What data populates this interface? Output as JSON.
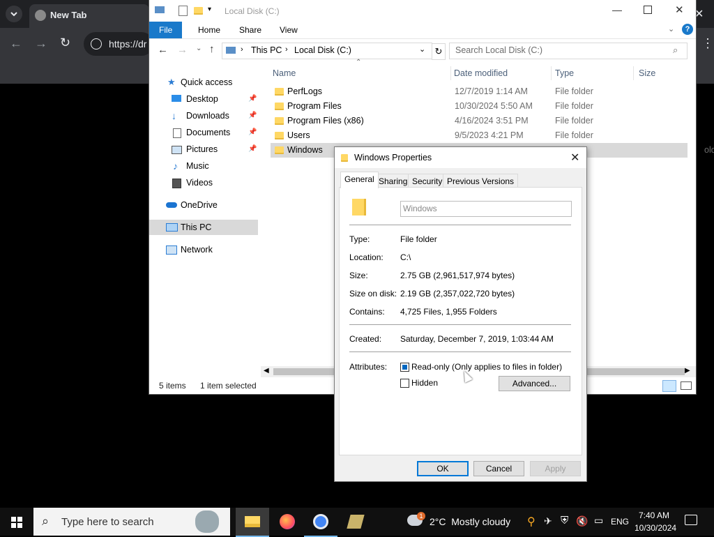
{
  "chrome": {
    "tab_title": "New Tab",
    "url": "https://dr",
    "accent": "#35363a"
  },
  "explorer": {
    "title": "Local Disk (C:)",
    "ribbon_tabs": [
      "File",
      "Home",
      "Share",
      "View"
    ],
    "breadcrumb": [
      "This PC",
      "Local Disk (C:)"
    ],
    "search_placeholder": "Search Local Disk (C:)",
    "nav": {
      "quick_access": "Quick access",
      "desktop": "Desktop",
      "downloads": "Downloads",
      "documents": "Documents",
      "pictures": "Pictures",
      "music": "Music",
      "videos": "Videos",
      "onedrive": "OneDrive",
      "this_pc": "This PC",
      "network": "Network"
    },
    "columns": {
      "name": "Name",
      "date": "Date modified",
      "type": "Type",
      "size": "Size"
    },
    "rows": [
      {
        "name": "PerfLogs",
        "date": "12/7/2019 1:14 AM",
        "type": "File folder"
      },
      {
        "name": "Program Files",
        "date": "10/30/2024 5:50 AM",
        "type": "File folder"
      },
      {
        "name": "Program Files (x86)",
        "date": "4/16/2024 3:51 PM",
        "type": "File folder"
      },
      {
        "name": "Users",
        "date": "9/5/2023 4:21 PM",
        "type": "File folder"
      },
      {
        "name": "Windows",
        "date": "",
        "type": "older"
      }
    ],
    "status_items": "5 items",
    "status_selected": "1 item selected"
  },
  "dialog": {
    "title": "Windows Properties",
    "tabs": [
      "General",
      "Sharing",
      "Security",
      "Previous Versions"
    ],
    "name_value": "Windows",
    "type_label": "Type:",
    "type_value": "File folder",
    "location_label": "Location:",
    "location_value": "C:\\",
    "size_label": "Size:",
    "size_value": "2.75 GB (2,961,517,974 bytes)",
    "size_disk_label": "Size on disk:",
    "size_disk_value": "2.19 GB (2,357,022,720 bytes)",
    "contains_label": "Contains:",
    "contains_value": "4,725 Files, 1,955 Folders",
    "created_label": "Created:",
    "created_value": "Saturday, December 7, 2019, 1:03:44 AM",
    "attributes_label": "Attributes:",
    "readonly_label": "Read-only (Only applies to files in folder)",
    "hidden_label": "Hidden",
    "advanced_label": "Advanced...",
    "ok_label": "OK",
    "cancel_label": "Cancel",
    "apply_label": "Apply"
  },
  "taskbar": {
    "search_placeholder": "Type here to search",
    "weather": "2°C  Mostly cloudy",
    "lang": "ENG",
    "time": "7:40 AM",
    "date": "10/30/2024",
    "weather_badge": "1"
  }
}
